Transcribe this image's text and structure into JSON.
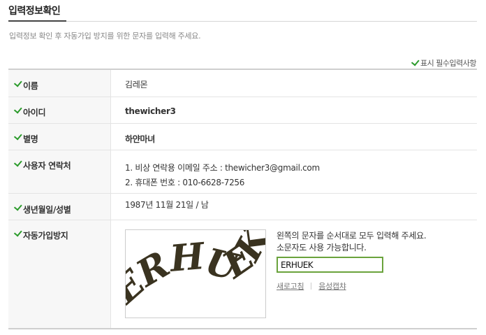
{
  "header": {
    "title": "입력정보확인",
    "subtitle": "입력정보 확인 후 자동가입 방지를 위한 문자를 입력해 주세요."
  },
  "required_note": "표시 필수입력사항",
  "rows": {
    "name": {
      "label": "이름",
      "value": "김레몬"
    },
    "id": {
      "label": "아이디",
      "value": "thewicher3"
    },
    "nickname": {
      "label": "별명",
      "value": "하얀마녀"
    },
    "contact": {
      "label": "사용자 연락처",
      "line1": "1. 비상 연락용 이메일 주소 : thewicher3@gmail.com",
      "line2": "2. 휴대폰 번호 : 010-6628-7256"
    },
    "birth": {
      "label": "생년월일/성별",
      "value": "1987년 11월 21일 / 남"
    },
    "captcha": {
      "label": "자동가입방지",
      "image_text": "ERHUEK",
      "instruction1": "왼쪽의 문자를 순서대로 모두 입력해 주세요.",
      "instruction2": "소문자도 사용 가능합니다.",
      "input_value": "ERHUEK",
      "refresh_label": "새로고침",
      "audio_label": "음성캡챠"
    }
  },
  "colors": {
    "check": "#2a9a2a",
    "input_border": "#6aa33c"
  }
}
